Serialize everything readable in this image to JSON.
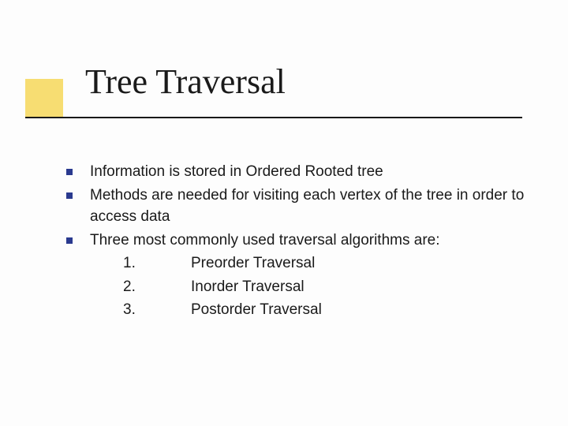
{
  "title": "Tree Traversal",
  "bullets": [
    {
      "text": "Information is stored in Ordered Rooted tree"
    },
    {
      "text": "Methods are needed for visiting each vertex of the tree in order to access data"
    },
    {
      "text": "Three most commonly used traversal algorithms are:"
    }
  ],
  "numbered": [
    {
      "n": "1.",
      "text": "Preorder Traversal"
    },
    {
      "n": "2.",
      "text": "Inorder Traversal"
    },
    {
      "n": "3.",
      "text": "Postorder Traversal"
    }
  ]
}
